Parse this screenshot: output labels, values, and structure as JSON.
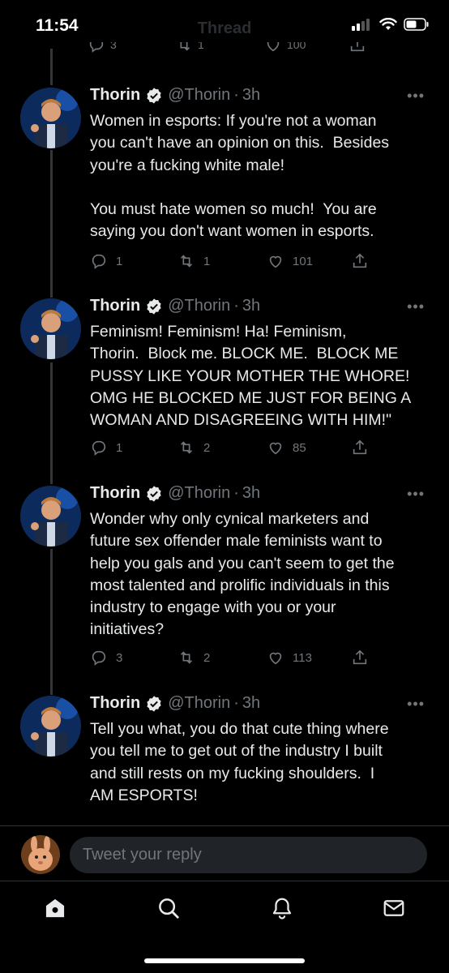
{
  "status_bar": {
    "time": "11:54",
    "title": "Thread"
  },
  "partial_actions": {
    "replies": "3",
    "retweets": "1",
    "likes": "100"
  },
  "tweets": [
    {
      "name": "Thorin",
      "handle": "@Thorin",
      "time": "3h",
      "text": "Women in esports: If you're not a woman\nyou can't have an opinion on this.  Besides\nyou're a fucking white male!\n\nYou must hate women so much!  You are\nsaying you don't want women in esports.",
      "replies": "1",
      "retweets": "1",
      "likes": "101"
    },
    {
      "name": "Thorin",
      "handle": "@Thorin",
      "time": "3h",
      "text": "Feminism! Feminism! Ha! Feminism,\nThorin.  Block me. BLOCK ME.  BLOCK ME\nPUSSY LIKE YOUR MOTHER THE WHORE!\nOMG HE BLOCKED ME JUST FOR BEING A\nWOMAN AND DISAGREEING WITH HIM!\"",
      "replies": "1",
      "retweets": "2",
      "likes": "85"
    },
    {
      "name": "Thorin",
      "handle": "@Thorin",
      "time": "3h",
      "text": "Wonder why only cynical marketers and\nfuture sex offender male feminists want to\nhelp you gals and you can't seem to get the\nmost talented and prolific individuals in this\nindustry to engage with you or your\ninitiatives?",
      "replies": "3",
      "retweets": "2",
      "likes": "113"
    },
    {
      "name": "Thorin",
      "handle": "@Thorin",
      "time": "3h",
      "text": "Tell you what, you do that cute thing where\nyou tell me to get out of the industry I built\nand still rests on my fucking shoulders.  I\nAM ESPORTS!"
    }
  ],
  "separator": "·",
  "more_glyph": "•••",
  "reply_bar": {
    "placeholder": "Tweet your reply"
  },
  "nav": [
    "home-icon",
    "search-icon",
    "notifications-icon",
    "messages-icon"
  ],
  "colors": {
    "background": "#000000",
    "text": "#e7e9ea",
    "muted": "#71767b",
    "verified": "#1d9bf0"
  }
}
